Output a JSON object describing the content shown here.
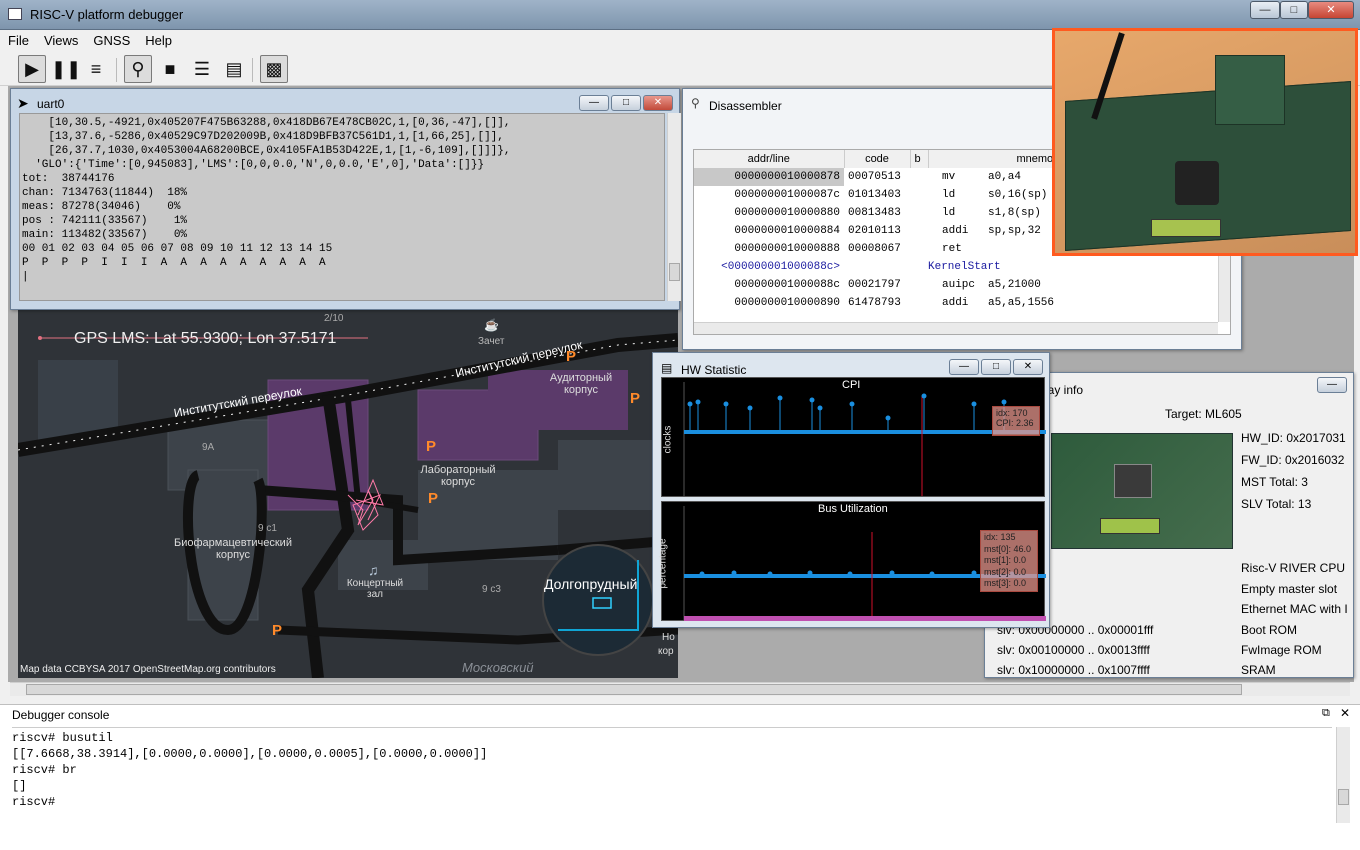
{
  "window": {
    "title": "RISC-V platform debugger",
    "controls": [
      "—",
      "□",
      "✕"
    ]
  },
  "menu": [
    "File",
    "Views",
    "GNSS",
    "Help"
  ],
  "toolbar": {
    "icons": [
      "play-icon",
      "pause-icon",
      "step-icon",
      "inspect-icon",
      "chip-icon",
      "layers-icon",
      "memory-icon",
      "board-icon"
    ]
  },
  "uart": {
    "title": "uart0",
    "lines": [
      "    [10,30.5,-4921,0x405207F475B63288,0x418DB67E478CB02C,1,[0,36,-47],[]],",
      "    [13,37.6,-5286,0x40529C97D202009B,0x418D9BFB37C561D1,1,[1,66,25],[]],",
      "    [26,37.7,1030,0x4053004A68200BCE,0x4105FA1B53D422E,1,[1,-6,109],[]]]},",
      "  'GLO':{'Time':[0,945083],'LMS':[0,0,0.0,'N',0,0.0,'E',0],'Data':[]}}",
      "tot:  38744176",
      "chan: 7134763(11844)  18%",
      "meas: 87278(34046)    0%",
      "pos : 742111(33567)    1%",
      "main: 113482(33567)    0%",
      "00 01 02 03 04 05 06 07 08 09 10 11 12 13 14 15",
      "P  P  P  P  I  I  I  A  A  A  A  A  A  A  A  A",
      "|"
    ]
  },
  "disassembler": {
    "title": "Disassembler",
    "headers": [
      "addr/line",
      "code",
      "b",
      "mnemonic"
    ],
    "rows": [
      {
        "addr": "0000000010000878",
        "code": "00070513",
        "b": "",
        "mnem": "mv",
        "args": "a0,a4"
      },
      {
        "addr": "000000001000087c",
        "code": "01013403",
        "b": "",
        "mnem": "ld",
        "args": "s0,16(sp)"
      },
      {
        "addr": "0000000010000880",
        "code": "00813483",
        "b": "",
        "mnem": "ld",
        "args": "s1,8(sp)"
      },
      {
        "addr": "0000000010000884",
        "code": "02010113",
        "b": "",
        "mnem": "addi",
        "args": "sp,sp,32"
      },
      {
        "addr": "0000000010000888",
        "code": "00008067",
        "b": "",
        "mnem": "ret",
        "args": ""
      },
      {
        "addr": "<000000001000088c>",
        "code": "",
        "b": "",
        "mnem": "KernelStart",
        "args": ""
      },
      {
        "addr": "000000001000088c",
        "code": "00021797",
        "b": "",
        "mnem": "auipc",
        "args": "a5,21000"
      },
      {
        "addr": "0000000010000890",
        "code": "61478793",
        "b": "",
        "mnem": "addi",
        "args": "a5,a5,1556"
      }
    ]
  },
  "map": {
    "gps_label": "GPS LMS: Lat 55.9300; Lon 37.5171",
    "streets": [
      "Институтский переулок",
      "Институтский переулок"
    ],
    "labels": [
      "Аудиторный корпус",
      "Лабораторный корпус",
      "Биофармацевтический корпус",
      "Концертный зал",
      "Долгопрудный",
      "Зачет",
      "Московский",
      "9А",
      "9 с1",
      "9 с3",
      "2/10",
      "Но",
      "кор",
      "7"
    ],
    "attribution": "Map data CCBYSA 2017 OpenStreetMap.org contributors"
  },
  "hw": {
    "title": "HW Statistic",
    "cpi": {
      "title": "CPI",
      "ylabel": "clocks",
      "tooltip": [
        "idx: 170",
        "CPI: 2.36"
      ]
    },
    "bus": {
      "title": "Bus Utilization",
      "ylabel": "percentage",
      "tooltip": [
        "idx: 135",
        "mst[0]: 46.0",
        "mst[1]: 0.0",
        "mst[2]: 0.0",
        "mst[3]: 0.0"
      ]
    }
  },
  "display": {
    "title_partial": "lay info",
    "target": "Target: ML605",
    "info": [
      "HW_ID: 0x2017031",
      "FW_ID: 0x2016032",
      "MST Total: 3",
      "SLV Total: 13"
    ],
    "devices": [
      "Risc-V RIVER CPU",
      "Empty master slot",
      "Ethernet MAC with I",
      "Boot ROM",
      "FwImage ROM",
      "SRAM"
    ],
    "slv": [
      "slv: 0x00000000 .. 0x00001fff",
      "slv: 0x00100000 .. 0x0013ffff",
      "slv: 0x10000000 .. 0x1007ffff"
    ]
  },
  "console": {
    "title": "Debugger console",
    "lines": [
      "riscv# busutil",
      "[[7.6668,38.3914],[0.0000,0.0000],[0.0000,0.0005],[0.0000,0.0000]]",
      "riscv# br",
      "[]",
      "riscv#"
    ]
  },
  "colors": {
    "accent": "#ff5a1f",
    "plot": "#1a8fe0",
    "marker": "#d0102a"
  }
}
